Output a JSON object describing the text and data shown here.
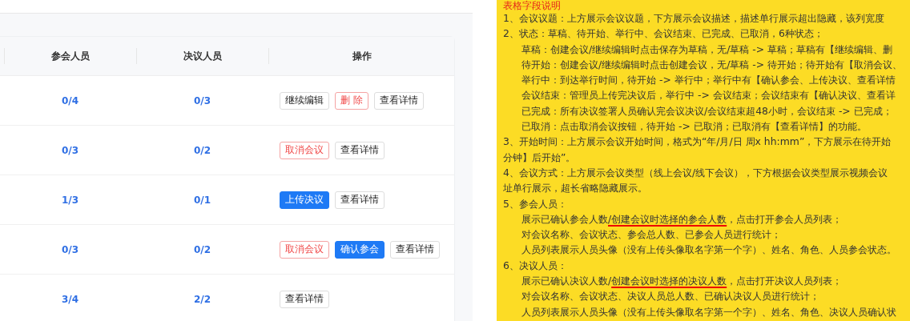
{
  "table": {
    "columns": [
      "参会人员",
      "决议人员",
      "操作"
    ],
    "rows": [
      {
        "attendees": "0/4",
        "resolvers": "0/3",
        "actions": [
          {
            "label": "继续编辑",
            "kind": "default"
          },
          {
            "label": "删 除",
            "kind": "danger"
          },
          {
            "label": "查看详情",
            "kind": "default"
          }
        ]
      },
      {
        "attendees": "0/3",
        "resolvers": "0/2",
        "actions": [
          {
            "label": "取消会议",
            "kind": "danger"
          },
          {
            "label": "查看详情",
            "kind": "default"
          }
        ]
      },
      {
        "attendees": "1/3",
        "resolvers": "0/1",
        "actions": [
          {
            "label": "上传决议",
            "kind": "primary"
          },
          {
            "label": "查看详情",
            "kind": "default"
          }
        ]
      },
      {
        "attendees": "0/3",
        "resolvers": "0/2",
        "actions": [
          {
            "label": "取消会议",
            "kind": "danger"
          },
          {
            "label": "确认参会",
            "kind": "primary"
          },
          {
            "label": "查看详情",
            "kind": "default"
          }
        ]
      },
      {
        "attendees": "3/4",
        "resolvers": "2/2",
        "actions": [
          {
            "label": "查看详情",
            "kind": "default"
          }
        ]
      }
    ]
  },
  "notes": {
    "title": "表格字段说明",
    "items": [
      {
        "lines": [
          "1、会议议题：上方展示会议议题，下方展示会议描述，描述单行展示超出隐藏，该列宽度"
        ]
      },
      {
        "lines": [
          "2、状态：草稿、待开始、举行中、会议结束、已完成、已取消，6种状态；"
        ],
        "children": [
          {
            "text": "草稿：创建会议/继续编辑时点击保存为草稿，无/草稿 -> 草稿；草稿有【继续编辑、删"
          },
          {
            "text": "待开始：创建会议/继续编辑时点击创建会议，无/草稿 -> 待开始；待开始有【取消会议、"
          },
          {
            "text": "举行中：到达举行时间，待开始 -> 举行中；举行中有【确认参会、上传决议、查看详情"
          },
          {
            "text": "会议结束：管理员上传完决议后，举行中 -> 会议结束；会议结束有【确认决议、查看详"
          },
          {
            "text": "已完成：所有决议签署人员确认完会议决议/会议结束超48小时，会议结束 -> 已完成；"
          },
          {
            "text": "已取消：点击取消会议按钮，待开始 -> 已取消；已取消有【查看详情】的功能。"
          }
        ]
      },
      {
        "lines": [
          "3、开始时间：上方展示会议开始时间，格式为“年/月/日 周x hh:mm”，下方展示在待开始",
          "分钟】后开始”。"
        ]
      },
      {
        "lines": [
          "4、会议方式：上方展示会议类型（线上会议/线下会议），下方根据会议类型展示视频会议",
          "址单行展示，超长省略隐藏展示。"
        ]
      },
      {
        "lines": [
          "5、参会人员："
        ],
        "children": [
          {
            "parts": [
              {
                "text": "展示已确认参会人数",
                "underlined": false
              },
              {
                "text": "/创建会议时选择的参会人数",
                "underlined": true
              },
              {
                "text": "，点击打开参会人员列表；",
                "underlined": false
              }
            ]
          },
          {
            "text": "对会议名称、会议状态、参会总人数、已参会人员进行统计；"
          },
          {
            "text": "人员列表展示人员头像（没有上传头像取名字第一个字）、姓名、角色、人员参会状态。"
          }
        ]
      },
      {
        "lines": [
          "6、决议人员："
        ],
        "children": [
          {
            "parts": [
              {
                "text": "展示已确认决议人数/",
                "underlined": false
              },
              {
                "text": "创建会议时选择的决议人数",
                "underlined": true
              },
              {
                "text": "，点击打开决议人员列表；",
                "underlined": false
              }
            ]
          },
          {
            "text": "对会议名称、会议状态、决议人员总人数、已确认决议人员进行统计；"
          },
          {
            "text": "人员列表展示人员头像（没有上传头像取名字第一个字）、姓名、角色、决议人员确认状"
          }
        ]
      }
    ]
  }
}
